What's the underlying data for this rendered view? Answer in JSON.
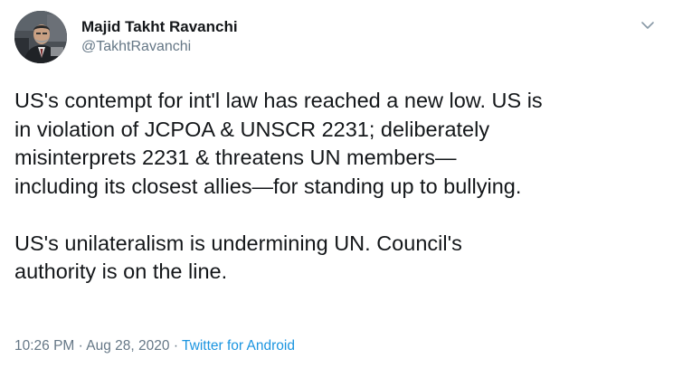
{
  "author": {
    "display_name": "Majid Takht Ravanchi",
    "handle": "@TakhtRavanchi"
  },
  "icons": {
    "menu": "chevron-down-icon",
    "avatar": "profile-photo"
  },
  "tweet": {
    "lines_p1": [
      "US's contempt for int'l law has reached a new low. US is",
      "in violation of JCPOA & UNSCR 2231; deliberately",
      "misinterprets 2231 & threatens UN members—",
      "including its closest allies—for standing up to bullying."
    ],
    "lines_p2": [
      "US's unilateralism is undermining UN. Council's",
      "authority is on the line."
    ]
  },
  "meta": {
    "time": "10:26 PM",
    "separator": "·",
    "date": "Aug 28, 2020",
    "source": "Twitter for Android"
  },
  "colors": {
    "text": "#14171a",
    "secondary": "#657786",
    "link": "#1b95e0",
    "background": "#ffffff"
  }
}
